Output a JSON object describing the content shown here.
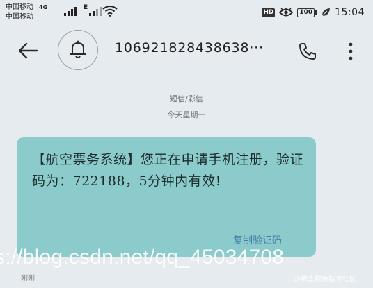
{
  "status_bar": {
    "carrier_1": "中国移动",
    "carrier_2": "中国移动",
    "network_1": "4G",
    "network_2": "E",
    "hd": "HD",
    "battery": "100",
    "time": "15:04"
  },
  "header": {
    "title": "106921828438638···"
  },
  "conversation": {
    "message_type": "短信/彩信",
    "date_label": "今天星期一",
    "message_text": "【航空票务系统】您正在申请手机注册，验证码为：722188，5分钟内有效!",
    "copy_code_label": "复制验证码",
    "bottom_stub": "刚刚"
  },
  "watermark": {
    "url": "s://blog.csdn.net/qq_45034708",
    "site": "@稀土掘金技术社区"
  }
}
